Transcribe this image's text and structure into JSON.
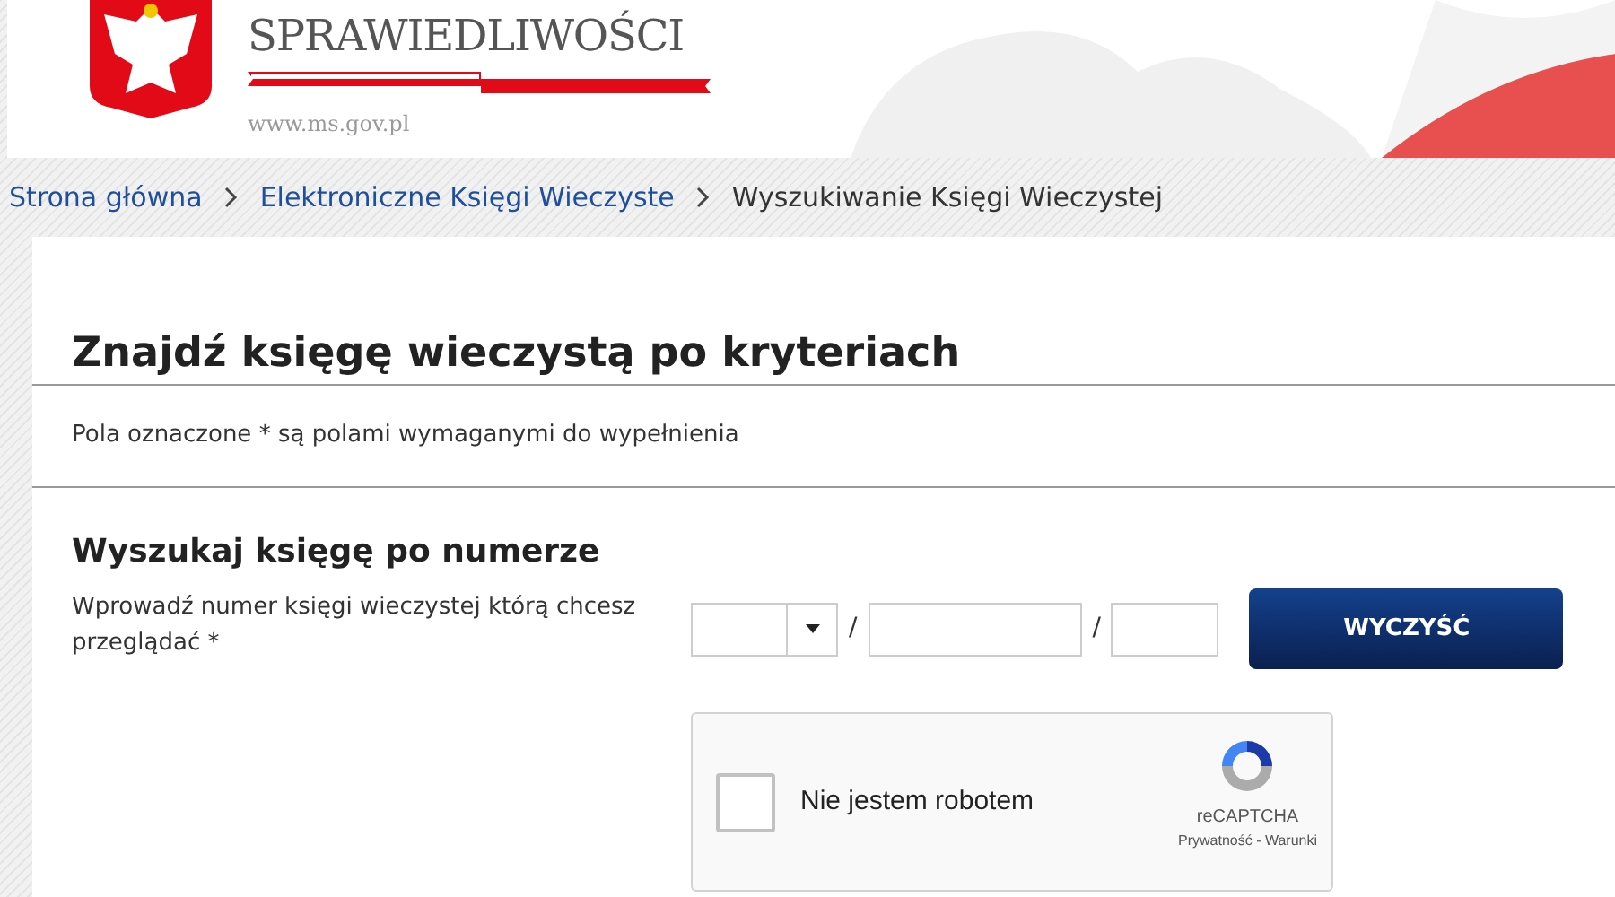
{
  "header": {
    "ministry": "SPRAWIEDLIWOŚCI",
    "url": "www.ms.gov.pl"
  },
  "breadcrumbs": [
    {
      "label": "Strona główna",
      "kind": "link"
    },
    {
      "label": "Elektroniczne Księgi Wieczyste",
      "kind": "link"
    },
    {
      "label": "Wyszukiwanie Księgi Wieczystej",
      "kind": "current"
    }
  ],
  "page_title": "Znajdź księgę wieczystą po kryteriach",
  "required_note": "Pola oznaczone * są polami wymaganymi do wypełnienia",
  "section": {
    "title": "Wyszukaj księgę po numerze",
    "label": "Wprowadź numer księgi wieczystej którą chcesz przeglądać *",
    "separators": [
      "/",
      "/"
    ],
    "clear_button": "WYCZYŚĆ"
  },
  "captcha": {
    "checked": false,
    "label": "Nie jestem robotem",
    "brand": "reCAPTCHA",
    "links": "Prywatność - Warunki"
  }
}
